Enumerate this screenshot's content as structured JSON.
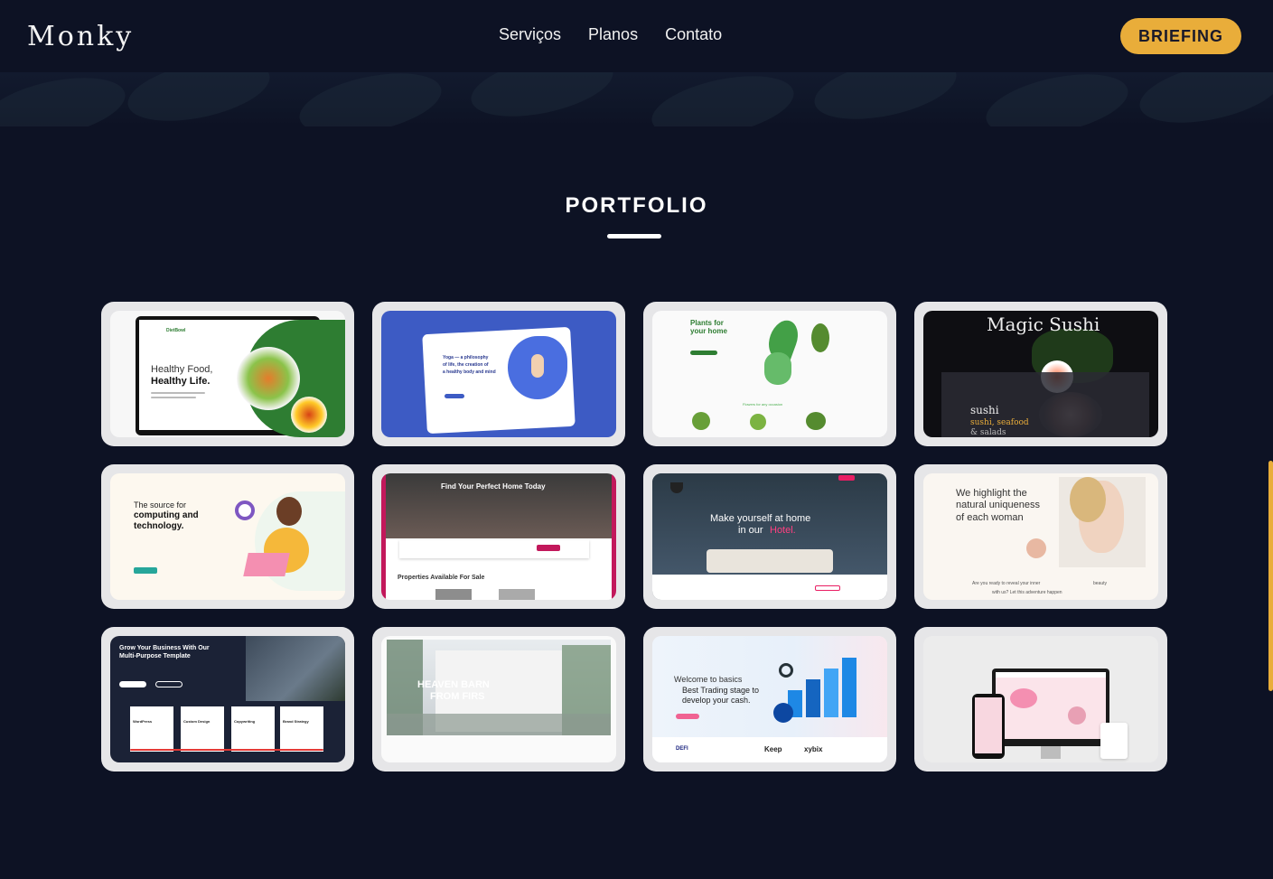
{
  "header": {
    "logo": "Monky",
    "nav": [
      "Serviços",
      "Planos",
      "Contato"
    ],
    "cta": "BRIEFING"
  },
  "portfolio": {
    "title": "PORTFOLIO",
    "items": [
      {
        "thumb_lines": [
          "Healthy Food,",
          "Healthy Life.",
          "DietBowl"
        ]
      },
      {
        "thumb_lines": [
          "Yoga — a philosophy",
          "of life, the creation of",
          "a healthy body and mind"
        ]
      },
      {
        "thumb_lines": [
          "Plants for",
          "your home",
          "Flowers for any occasion"
        ]
      },
      {
        "thumb_lines": [
          "Magic Sushi",
          "sushi",
          "sushi, seafood",
          "& salads"
        ]
      },
      {
        "thumb_lines": [
          "The source for",
          "computing and",
          "technology."
        ]
      },
      {
        "thumb_lines": [
          "Find Your Perfect Home Today",
          "Properties Available For Sale"
        ]
      },
      {
        "thumb_lines": [
          "Make yourself at home",
          "in our",
          "Hotel."
        ]
      },
      {
        "thumb_lines": [
          "We highlight the",
          "natural uniqueness",
          "of each woman",
          "Are you ready to reveal your inner",
          "beauty",
          "with us? Let this adventure happen"
        ]
      },
      {
        "thumb_lines": [
          "Grow Your Business With Our",
          "Multi-Purpose Template",
          "WordPress",
          "Custom Design",
          "Copywriting",
          "Brand Strategy"
        ]
      },
      {
        "thumb_lines": [
          "HEAVEN BARN",
          "FROM FIRS"
        ]
      },
      {
        "thumb_lines": [
          "Welcome to basics",
          "Best Trading stage to",
          "develop your cash.",
          "DEFI",
          "Keep",
          "xybix"
        ]
      },
      {
        "thumb_lines": [
          ""
        ]
      }
    ]
  },
  "colors": {
    "background": "#0d1224",
    "accent": "#e9ad3a",
    "card": "#e6e6e8"
  }
}
